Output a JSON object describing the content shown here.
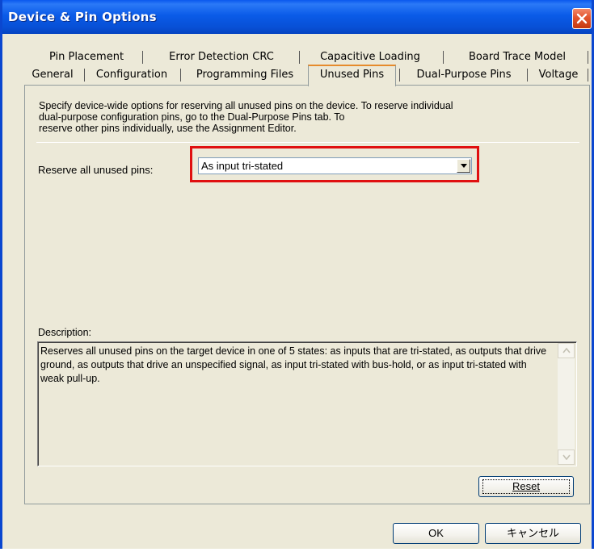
{
  "window": {
    "title": "Device & Pin Options"
  },
  "tabs": {
    "row1": [
      "Pin Placement",
      "Error Detection CRC",
      "Capacitive Loading",
      "Board Trace Model"
    ],
    "row2": [
      "General",
      "Configuration",
      "Programming Files",
      "Unused Pins",
      "Dual-Purpose Pins",
      "Voltage"
    ],
    "active": "Unused Pins"
  },
  "intro": {
    "line1": "Specify device-wide options for reserving all unused pins on the device. To reserve individual",
    "line2": "dual-purpose configuration pins, go to the Dual-Purpose Pins tab. To",
    "line3": "reserve other pins individually, use the Assignment Editor."
  },
  "reserve": {
    "label": "Reserve all unused pins:",
    "value": "As input tri-stated"
  },
  "description": {
    "label": "Description:",
    "text": "Reserves all unused pins on the target device in one of 5 states: as inputs that are tri-stated, as outputs that drive ground, as outputs that drive an unspecified signal, as input tri-stated with bus-hold, or as input tri-stated with weak pull-up."
  },
  "buttons": {
    "reset": "Reset",
    "ok": "OK",
    "cancel": "キャンセル"
  },
  "colors": {
    "titlebar": "#0a5be8",
    "highlight_box": "#e01010",
    "dialog_bg": "#ece9d8"
  },
  "icons": [
    "close-icon",
    "dropdown-arrow-icon",
    "scroll-up-arrow-icon",
    "scroll-down-arrow-icon"
  ]
}
